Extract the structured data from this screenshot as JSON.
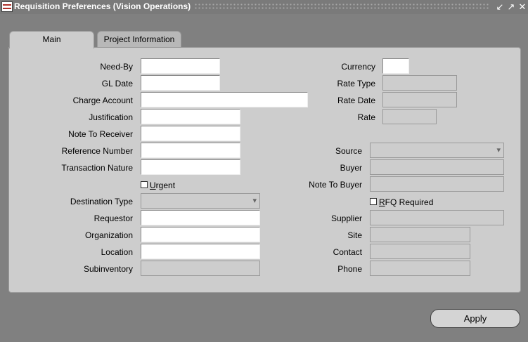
{
  "window": {
    "title": "Requisition Preferences (Vision Operations)"
  },
  "tabs": {
    "main": "Main",
    "project": "Project Information"
  },
  "left": {
    "need_by": "Need-By",
    "gl_date": "GL Date",
    "charge_account": "Charge Account",
    "justification": "Justification",
    "note_to_receiver": "Note To Receiver",
    "reference_number": "Reference Number",
    "transaction_nature": "Transaction Nature",
    "urgent_first": "U",
    "urgent_rest": "rgent",
    "destination_type": "Destination Type",
    "requestor": "Requestor",
    "organization": "Organization",
    "location": "Location",
    "subinventory": "Subinventory"
  },
  "right": {
    "currency": "Currency",
    "rate_type": "Rate Type",
    "rate_date": "Rate Date",
    "rate": "Rate",
    "source": "Source",
    "buyer": "Buyer",
    "note_to_buyer": "Note To Buyer",
    "rfq_first": "R",
    "rfq_rest": "FQ Required",
    "supplier": "Supplier",
    "site": "Site",
    "contact": "Contact",
    "phone": "Phone"
  },
  "buttons": {
    "apply": "Apply"
  }
}
